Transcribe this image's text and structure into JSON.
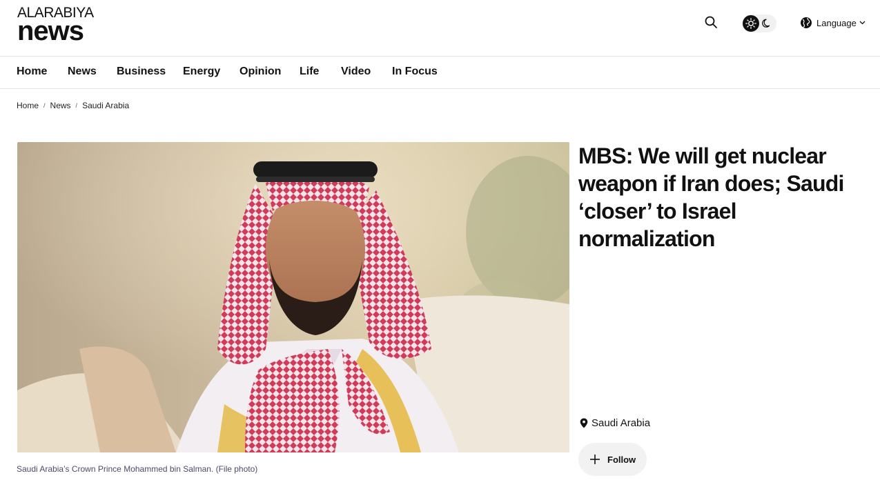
{
  "logo": {
    "top_text": "ALARABIYA",
    "bottom_text": "news"
  },
  "header": {
    "language_label": "Language"
  },
  "nav": {
    "items": [
      {
        "label": "Home"
      },
      {
        "label": "News"
      },
      {
        "label": "Business"
      },
      {
        "label": "Energy"
      },
      {
        "label": "Opinion"
      },
      {
        "label": "Life"
      },
      {
        "label": "Video"
      },
      {
        "label": "In Focus"
      }
    ]
  },
  "breadcrumb": {
    "items": [
      "Home",
      "News",
      "Saudi Arabia"
    ],
    "separator": "/"
  },
  "article": {
    "image_caption": "Saudi Arabia’s Crown Prince Mohammed bin Salman. (File photo)",
    "headline": "MBS: We will get nuclear weapon if Iran does; Saudi ‘closer’ to Israel normalization",
    "location": "Saudi Arabia",
    "follow_label": "Follow"
  },
  "icons": {
    "search": "search-icon",
    "theme_light": "sun-icon",
    "theme_dark": "moon-icon",
    "language": "globe-icon",
    "dropdown": "chevron-down-icon",
    "location": "map-pin-icon",
    "follow": "plus-icon"
  },
  "colors": {
    "text": "#111111",
    "caption": "#4a4a6a",
    "divider": "#e3e3e3",
    "button_bg": "#f2f2f2"
  }
}
